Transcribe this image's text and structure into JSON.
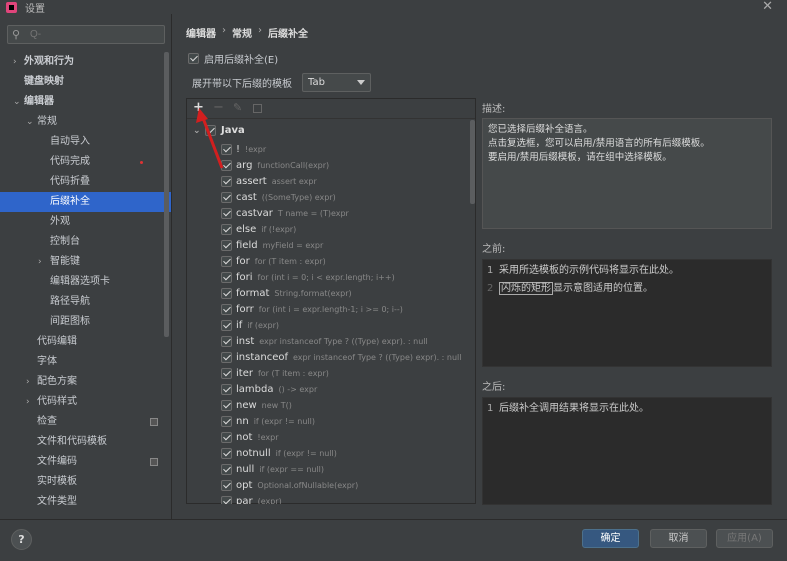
{
  "window": {
    "title": "设置"
  },
  "sidebar": {
    "search_placeholder": "Q-",
    "items": [
      {
        "label": "外观和行为",
        "arrow": "›",
        "level": 0
      },
      {
        "label": "键盘映射",
        "level": 0
      },
      {
        "label": "编辑器",
        "arrow": "⌄",
        "level": 0
      },
      {
        "label": "常规",
        "arrow": "⌄",
        "level": 1
      },
      {
        "label": "自动导入",
        "level": 2
      },
      {
        "label": "代码完成",
        "level": 2
      },
      {
        "label": "代码折叠",
        "level": 2
      },
      {
        "label": "后缀补全",
        "level": 2,
        "selected": true
      },
      {
        "label": "外观",
        "level": 2
      },
      {
        "label": "控制台",
        "level": 2
      },
      {
        "label": "智能键",
        "arrow": "›",
        "level": 2
      },
      {
        "label": "编辑器选项卡",
        "level": 2
      },
      {
        "label": "路径导航",
        "level": 2
      },
      {
        "label": "间距图标",
        "level": 2
      },
      {
        "label": "代码编辑",
        "level": 1
      },
      {
        "label": "字体",
        "level": 1
      },
      {
        "label": "配色方案",
        "arrow": "›",
        "level": 1
      },
      {
        "label": "代码样式",
        "arrow": "›",
        "level": 1
      },
      {
        "label": "检查",
        "level": 1,
        "badge": true
      },
      {
        "label": "文件和代码模板",
        "level": 1
      },
      {
        "label": "文件编码",
        "level": 1,
        "badge": true
      },
      {
        "label": "实时模板",
        "level": 1
      },
      {
        "label": "文件类型",
        "level": 1
      }
    ]
  },
  "breadcrumb": [
    "编辑器",
    "常规",
    "后缀补全"
  ],
  "enable_postfix": {
    "label": "启用后缀补全(E)",
    "checked": true
  },
  "expand_template": {
    "label": "展开带以下后缀的模板",
    "value": "Tab"
  },
  "templates": {
    "group": "Java",
    "items": [
      {
        "key": "!",
        "desc": "!expr"
      },
      {
        "key": "arg",
        "desc": "functionCall(expr)"
      },
      {
        "key": "assert",
        "desc": "assert expr"
      },
      {
        "key": "cast",
        "desc": "((SomeType) expr)"
      },
      {
        "key": "castvar",
        "desc": "T name = (T)expr"
      },
      {
        "key": "else",
        "desc": "if (!expr)"
      },
      {
        "key": "field",
        "desc": "myField = expr"
      },
      {
        "key": "for",
        "desc": "for (T item : expr)"
      },
      {
        "key": "fori",
        "desc": "for (int i = 0; i < expr.length; i++)"
      },
      {
        "key": "format",
        "desc": "String.format(expr)"
      },
      {
        "key": "forr",
        "desc": "for (int i = expr.length-1; i >= 0; i--)"
      },
      {
        "key": "if",
        "desc": "if (expr)"
      },
      {
        "key": "inst",
        "desc": "expr instanceof Type ? ((Type) expr). : null"
      },
      {
        "key": "instanceof",
        "desc": "expr instanceof Type ? ((Type) expr). : null"
      },
      {
        "key": "iter",
        "desc": "for (T item : expr)"
      },
      {
        "key": "lambda",
        "desc": "() -> expr"
      },
      {
        "key": "new",
        "desc": "new T()"
      },
      {
        "key": "nn",
        "desc": "if (expr != null)"
      },
      {
        "key": "not",
        "desc": "!expr"
      },
      {
        "key": "notnull",
        "desc": "if (expr != null)"
      },
      {
        "key": "null",
        "desc": "if (expr == null)"
      },
      {
        "key": "opt",
        "desc": "Optional.ofNullable(expr)"
      },
      {
        "key": "par",
        "desc": "(expr)"
      }
    ]
  },
  "description": {
    "label": "描述:",
    "lines": [
      "您已选择后缀补全语言。",
      "点击复选框，您可以启用/禁用语言的所有后缀模板。",
      "要启用/禁用后缀模板，请在组中选择模板。"
    ]
  },
  "before": {
    "label": "之前:",
    "line1_num": "1",
    "line1": "采用所选模板的示例代码将显示在此处。",
    "line2_num": "2",
    "line2_boxed": "闪烁的矩形",
    "line2_rest": "显示意图适用的位置。"
  },
  "after": {
    "label": "之后:",
    "line1_num": "1",
    "line1": "后缀补全调用结果将显示在此处。"
  },
  "buttons": {
    "ok": "确定",
    "cancel": "取消",
    "apply": "应用(A)",
    "help": "?"
  },
  "colors": {
    "selection": "#2f65ca",
    "primary_button": "#365880",
    "annotation_arrow": "#d21f1f"
  }
}
